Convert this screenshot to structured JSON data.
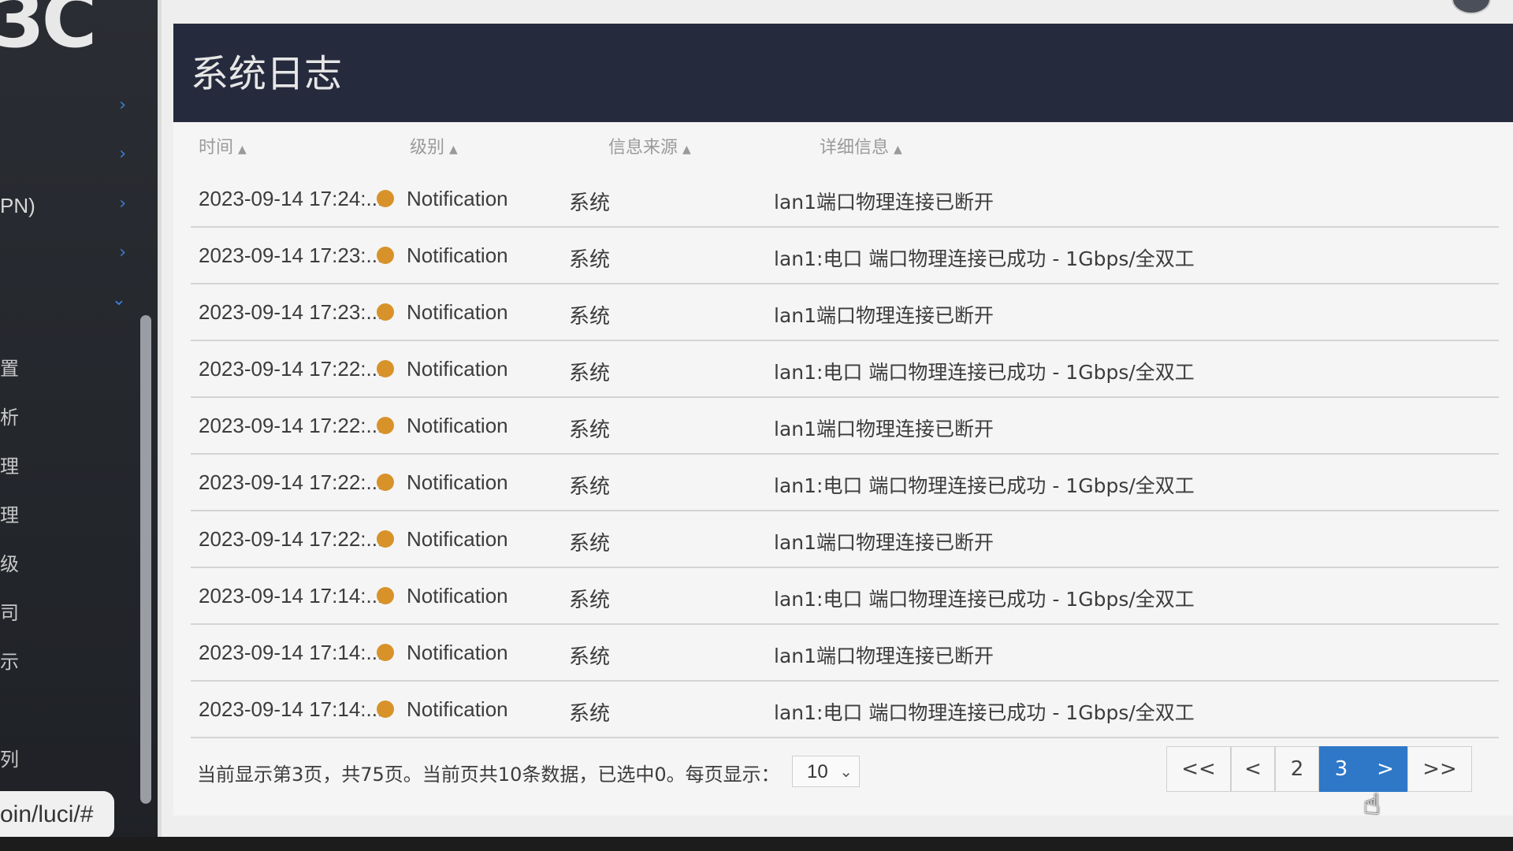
{
  "sidebar": {
    "logo": "3C",
    "rows": [
      {
        "label": "",
        "chevron": "›"
      },
      {
        "label": "",
        "chevron": "›"
      },
      {
        "label": "PN)",
        "chevron": "›"
      },
      {
        "label": "",
        "chevron": "›"
      },
      {
        "label": "",
        "chevron": "⌄"
      }
    ],
    "chars": [
      "置",
      "析",
      "理",
      "理",
      "级",
      "司",
      "示",
      "列"
    ],
    "url": "oin/luci/#"
  },
  "header": {
    "title": "系统日志"
  },
  "table": {
    "columns": [
      "时间",
      "级别",
      "信息来源",
      "详细信息"
    ],
    "rows": [
      {
        "time": "2023-09-14 17:24:...",
        "level": "Notification",
        "source": "系统",
        "detail": "lan1端口物理连接已断开"
      },
      {
        "time": "2023-09-14 17:23:...",
        "level": "Notification",
        "source": "系统",
        "detail": "lan1:电口 端口物理连接已成功 - 1Gbps/全双工"
      },
      {
        "time": "2023-09-14 17:23:...",
        "level": "Notification",
        "source": "系统",
        "detail": "lan1端口物理连接已断开"
      },
      {
        "time": "2023-09-14 17:22:...",
        "level": "Notification",
        "source": "系统",
        "detail": "lan1:电口 端口物理连接已成功 - 1Gbps/全双工"
      },
      {
        "time": "2023-09-14 17:22:...",
        "level": "Notification",
        "source": "系统",
        "detail": "lan1端口物理连接已断开"
      },
      {
        "time": "2023-09-14 17:22:...",
        "level": "Notification",
        "source": "系统",
        "detail": "lan1:电口 端口物理连接已成功 - 1Gbps/全双工"
      },
      {
        "time": "2023-09-14 17:22:...",
        "level": "Notification",
        "source": "系统",
        "detail": "lan1端口物理连接已断开"
      },
      {
        "time": "2023-09-14 17:14:...",
        "level": "Notification",
        "source": "系统",
        "detail": "lan1:电口 端口物理连接已成功 - 1Gbps/全双工"
      },
      {
        "time": "2023-09-14 17:14:...",
        "level": "Notification",
        "source": "系统",
        "detail": "lan1端口物理连接已断开"
      },
      {
        "time": "2023-09-14 17:14:...",
        "level": "Notification",
        "source": "系统",
        "detail": "lan1:电口 端口物理连接已成功 - 1Gbps/全双工"
      }
    ]
  },
  "footer": {
    "summary": "当前显示第3页，共75页。当前页共10条数据，已选中0。每页显示：",
    "per_page": "10"
  },
  "pager": {
    "first": "<<",
    "prev": "<",
    "page_prev": "2",
    "page_current": "3",
    "next": ">",
    "last": ">>"
  },
  "colors": {
    "header_bg": "#262a3d",
    "level_dot": "#d8922a",
    "accent": "#2f78c8"
  }
}
